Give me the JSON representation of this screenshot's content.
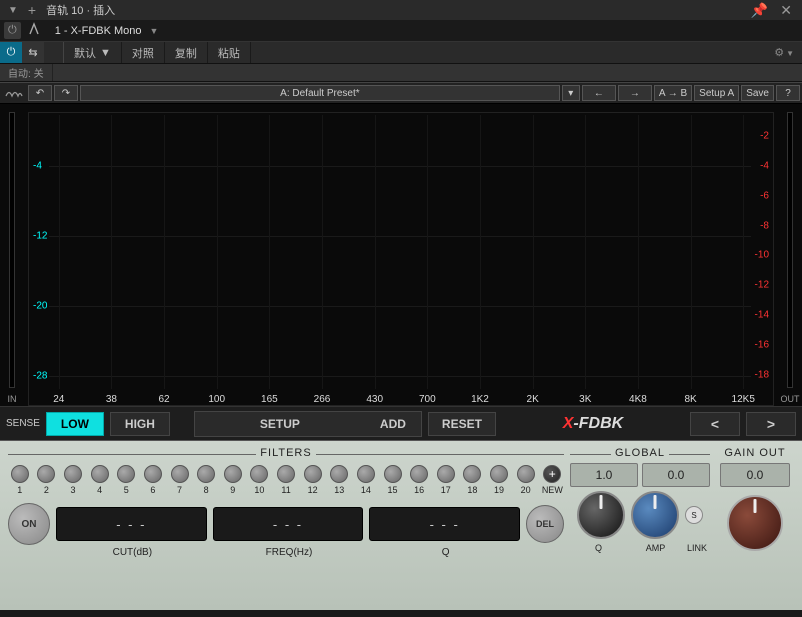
{
  "titlebar": {
    "title": "音轨 10 · 插入"
  },
  "plugin": {
    "slot": "1 - X-FDBK Mono"
  },
  "tabs": {
    "default": "默认",
    "compare": "对照",
    "copy": "复制",
    "paste": "粘贴"
  },
  "autorow": {
    "auto": "自动:",
    "off": "关"
  },
  "presetbar": {
    "undo": "↶",
    "redo": "↷",
    "preset_name": "A: Default Preset*",
    "prev": "←",
    "next": "→",
    "ab": "A → B",
    "setup": "Setup A",
    "save": "Save"
  },
  "graph": {
    "y_left": [
      "-4",
      "-12",
      "-20",
      "-28"
    ],
    "y_right": [
      "-2",
      "-4",
      "-6",
      "-8",
      "-10",
      "-12",
      "-14",
      "-16",
      "-18"
    ],
    "x_labels": [
      "24",
      "38",
      "62",
      "100",
      "165",
      "266",
      "430",
      "700",
      "1K2",
      "2K",
      "3K",
      "4K8",
      "8K",
      "12K5"
    ],
    "in": "IN",
    "out": "OUT"
  },
  "controls": {
    "sense": "SENSE",
    "low": "LOW",
    "high": "HIGH",
    "setup": "SETUP",
    "add": "ADD",
    "reset": "RESET",
    "brand_x": "X",
    "brand_rest": "-FDBK",
    "prev": "<",
    "next": ">"
  },
  "filters": {
    "label": "FILTERS",
    "new": "NEW",
    "on": "ON",
    "del": "DEL",
    "cut_val": "- - -",
    "freq_val": "- - -",
    "q_val": "- - -",
    "labels": {
      "cut": "CUT(dB)",
      "freq": "FREQ(Hz)",
      "q": "Q"
    },
    "nums": [
      "1",
      "2",
      "3",
      "4",
      "5",
      "6",
      "7",
      "8",
      "9",
      "10",
      "11",
      "12",
      "13",
      "14",
      "15",
      "16",
      "17",
      "18",
      "19",
      "20"
    ]
  },
  "global": {
    "label": "GLOBAL",
    "q_val": "1.0",
    "amp_val": "0.0",
    "q_lbl": "Q",
    "amp_lbl": "AMP",
    "link_lbl": "LINK",
    "link_sw": "S"
  },
  "gain": {
    "label": "GAIN OUT",
    "val": "0.0"
  }
}
